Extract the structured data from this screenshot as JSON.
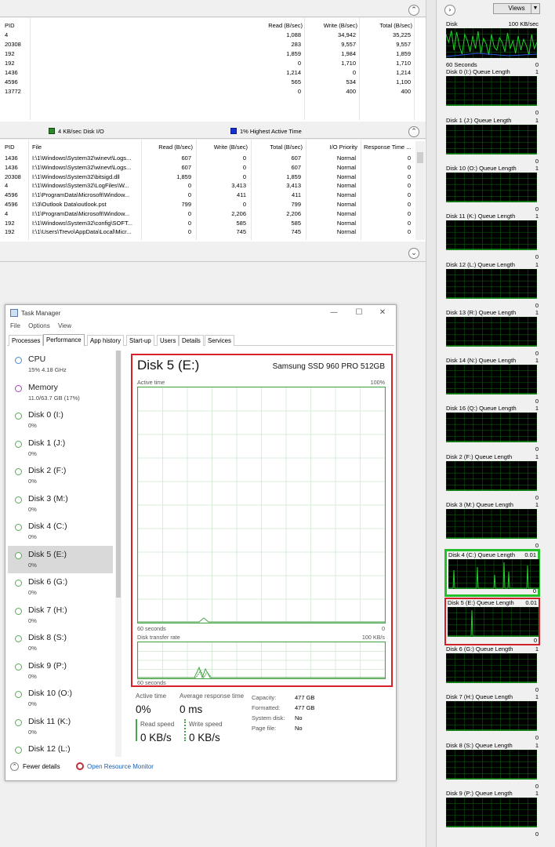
{
  "process_table": {
    "headers": {
      "pid": "PID",
      "read": "Read (B/sec)",
      "write": "Write (B/sec)",
      "total": "Total (B/sec)"
    },
    "rows": [
      {
        "pid": "4",
        "read": "1,088",
        "write": "34,942",
        "total": "35,225"
      },
      {
        "pid": "20308",
        "read": "283",
        "write": "9,557",
        "total": "9,557"
      },
      {
        "pid": "192",
        "read": "1,859",
        "write": "1,984",
        "total": "1,859"
      },
      {
        "pid": "192",
        "read": "0",
        "write": "1,710",
        "total": "1,710"
      },
      {
        "pid": "1436",
        "read": "1,214",
        "write": "0",
        "total": "1,214"
      },
      {
        "pid": "4596",
        "read": "565",
        "write": "534",
        "total": "1,100"
      },
      {
        "pid": "13772",
        "read": "0",
        "write": "400",
        "total": "400"
      }
    ]
  },
  "disk_section": {
    "disk_io": "4 KB/sec Disk I/O",
    "active_time": "1% Highest Active Time",
    "headers": {
      "pid": "PID",
      "file": "File",
      "read": "Read (B/sec)",
      "write": "Write (B/sec)",
      "total": "Total (B/sec)",
      "priority": "I/O Priority",
      "response": "Response Time ..."
    },
    "rows": [
      {
        "pid": "1436",
        "file": "I:\\1\\Windows\\System32\\winevt\\Logs...",
        "read": "607",
        "write": "0",
        "total": "607",
        "priority": "Normal",
        "response": "0"
      },
      {
        "pid": "1436",
        "file": "I:\\1\\Windows\\System32\\winevt\\Logs...",
        "read": "607",
        "write": "0",
        "total": "607",
        "priority": "Normal",
        "response": "0"
      },
      {
        "pid": "20308",
        "file": "I:\\1\\Windows\\System32\\bitsigd.dll",
        "read": "1,859",
        "write": "0",
        "total": "1,859",
        "priority": "Normal",
        "response": "0"
      },
      {
        "pid": "4",
        "file": "I:\\1\\Windows\\System32\\LogFiles\\W...",
        "read": "0",
        "write": "3,413",
        "total": "3,413",
        "priority": "Normal",
        "response": "0"
      },
      {
        "pid": "4596",
        "file": "I:\\1\\ProgramData\\Microsoft\\Window...",
        "read": "0",
        "write": "411",
        "total": "411",
        "priority": "Normal",
        "response": "0"
      },
      {
        "pid": "4596",
        "file": "I:\\3\\Outlook Data\\outlook.pst",
        "read": "799",
        "write": "0",
        "total": "799",
        "priority": "Normal",
        "response": "0"
      },
      {
        "pid": "4",
        "file": "I:\\1\\ProgramData\\Microsoft\\Window...",
        "read": "0",
        "write": "2,206",
        "total": "2,206",
        "priority": "Normal",
        "response": "0"
      },
      {
        "pid": "192",
        "file": "I:\\1\\Windows\\System32\\config\\SOFT...",
        "read": "0",
        "write": "585",
        "total": "585",
        "priority": "Normal",
        "response": "0"
      },
      {
        "pid": "192",
        "file": "I:\\1\\Users\\Trevo\\AppData\\Local\\Micr...",
        "read": "0",
        "write": "745",
        "total": "745",
        "priority": "Normal",
        "response": "0"
      }
    ]
  },
  "graph_panel": {
    "views_label": "Views",
    "graphs": [
      {
        "title": "Disk",
        "value": "100 KB/sec",
        "bottom_left": "60 Seconds",
        "bottom_right": "0"
      },
      {
        "title": "Disk 0 (I:) Queue Length",
        "value": "1",
        "bottom_right": "0"
      },
      {
        "title": "Disk 1 (J:) Queue Length",
        "value": "1",
        "bottom_right": "0"
      },
      {
        "title": "Disk 10 (O:) Queue Length",
        "value": "1",
        "bottom_right": "0"
      },
      {
        "title": "Disk 11 (K:) Queue Length",
        "value": "1",
        "bottom_right": "0"
      },
      {
        "title": "Disk 12 (L:) Queue Length",
        "value": "1",
        "bottom_right": "0"
      },
      {
        "title": "Disk 13 (R:) Queue Length",
        "value": "1",
        "bottom_right": "0"
      },
      {
        "title": "Disk 14 (N:) Queue Length",
        "value": "1",
        "bottom_right": "0"
      },
      {
        "title": "Disk 16 (Q:) Queue Length",
        "value": "1",
        "bottom_right": "0"
      },
      {
        "title": "Disk 2 (F:) Queue Length",
        "value": "1",
        "bottom_right": "0"
      },
      {
        "title": "Disk 3 (M:) Queue Length",
        "value": "1",
        "bottom_right": "0"
      },
      {
        "title": "Disk 4 (C:) Queue Length",
        "value": "0.01",
        "bottom_right": "0"
      },
      {
        "title": "Disk 5 (E:) Queue Length",
        "value": "0.01",
        "bottom_right": "0"
      },
      {
        "title": "Disk 6 (G:) Queue Length",
        "value": "1",
        "bottom_right": "0"
      },
      {
        "title": "Disk 7 (H:) Queue Length",
        "value": "1",
        "bottom_right": "0"
      },
      {
        "title": "Disk 8 (S:) Queue Length",
        "value": "1",
        "bottom_right": "0"
      },
      {
        "title": "Disk 9 (P:) Queue Length",
        "value": "1",
        "bottom_right": "0"
      }
    ]
  },
  "task_manager": {
    "title": "Task Manager",
    "menu": [
      "File",
      "Options",
      "View"
    ],
    "tabs": [
      "Processes",
      "Performance",
      "App history",
      "Start-up",
      "Users",
      "Details",
      "Services"
    ],
    "sidebar": [
      {
        "name": "CPU",
        "sub": "15% 4.18 GHz"
      },
      {
        "name": "Memory",
        "sub": "11.0/63.7 GB (17%)"
      },
      {
        "name": "Disk 0 (I:)",
        "sub": "0%"
      },
      {
        "name": "Disk 1 (J:)",
        "sub": "0%"
      },
      {
        "name": "Disk 2 (F:)",
        "sub": "0%"
      },
      {
        "name": "Disk 3 (M:)",
        "sub": "0%"
      },
      {
        "name": "Disk 4 (C:)",
        "sub": "0%"
      },
      {
        "name": "Disk 5 (E:)",
        "sub": "0%"
      },
      {
        "name": "Disk 6 (G:)",
        "sub": "0%"
      },
      {
        "name": "Disk 7 (H:)",
        "sub": "0%"
      },
      {
        "name": "Disk 8 (S:)",
        "sub": "0%"
      },
      {
        "name": "Disk 9 (P:)",
        "sub": "0%"
      },
      {
        "name": "Disk 10 (O:)",
        "sub": "0%"
      },
      {
        "name": "Disk 11 (K:)",
        "sub": "0%"
      },
      {
        "name": "Disk 12 (L:)",
        "sub": ""
      }
    ],
    "disk_title": "Disk 5 (E:)",
    "disk_model": "Samsung SSD 960 PRO 512GB",
    "active_time_label": "Active time",
    "active_time_max": "100%",
    "sixty_seconds": "60 seconds",
    "zero": "0",
    "transfer_label": "Disk transfer rate",
    "transfer_max": "100 KB/s",
    "stats": {
      "active_time_label": "Active time",
      "active_time_value": "0%",
      "avg_response_label": "Average response time",
      "avg_response_value": "0 ms",
      "read_speed_label": "Read speed",
      "read_speed_value": "0 KB/s",
      "write_speed_label": "Write speed",
      "write_speed_value": "0 KB/s",
      "capacity_label": "Capacity:",
      "capacity_value": "477 GB",
      "formatted_label": "Formatted:",
      "formatted_value": "477 GB",
      "system_disk_label": "System disk:",
      "system_disk_value": "No",
      "page_file_label": "Page file:",
      "page_file_value": "No"
    },
    "fewer_details": "Fewer details",
    "open_resource_monitor": "Open Resource Monitor"
  },
  "colors": {
    "graph_green": "#22c02a",
    "highlight_red": "#d9202a"
  }
}
